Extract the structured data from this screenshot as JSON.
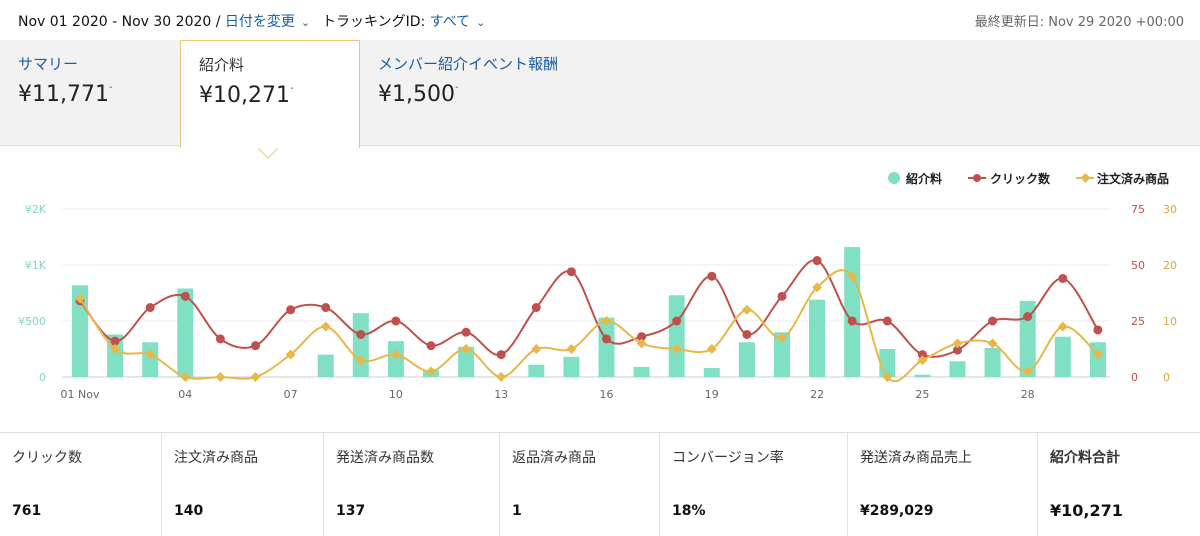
{
  "header": {
    "date_range": "Nov 01 2020 - Nov 30 2020 /",
    "change_date": "日付を変更",
    "tracking_label": "トラッキングID:",
    "tracking_value": "すべて",
    "last_updated": "最終更新日: Nov 29 2020 +00:00"
  },
  "tabs": [
    {
      "label": "サマリー",
      "value": "¥11,771"
    },
    {
      "label": "紹介料",
      "value": "¥10,271"
    },
    {
      "label": "メンバー紹介イベント報酬",
      "value": "¥1,500"
    }
  ],
  "value_suffix": "-",
  "icons": {
    "chevron": "chevron-down-icon"
  },
  "colors": {
    "bars": "#7fe0c3",
    "clicks": "#c0504d",
    "orders": "#e6b84a",
    "link": "#1a5ea8"
  },
  "stats": [
    {
      "label": "クリック数",
      "value": "761"
    },
    {
      "label": "注文済み商品",
      "value": "140"
    },
    {
      "label": "発送済み商品数",
      "value": "137"
    },
    {
      "label": "返品済み商品",
      "value": "1"
    },
    {
      "label": "コンバージョン率",
      "value": "18%"
    },
    {
      "label": "発送済み商品売上",
      "value": "¥289,029"
    },
    {
      "label": "紹介料合計",
      "value": "¥10,271"
    }
  ],
  "chart_data": {
    "type": "bar",
    "x": [
      1,
      2,
      3,
      4,
      5,
      6,
      7,
      8,
      9,
      10,
      11,
      12,
      13,
      14,
      15,
      16,
      17,
      18,
      19,
      20,
      21,
      22,
      23,
      24,
      25,
      26,
      27,
      28,
      29,
      30
    ],
    "x_tick_labels": [
      {
        "x": 1,
        "label": "01 Nov"
      },
      {
        "x": 4,
        "label": "04"
      },
      {
        "x": 7,
        "label": "07"
      },
      {
        "x": 10,
        "label": "10"
      },
      {
        "x": 13,
        "label": "13"
      },
      {
        "x": 16,
        "label": "16"
      },
      {
        "x": 19,
        "label": "19"
      },
      {
        "x": 22,
        "label": "22"
      },
      {
        "x": 25,
        "label": "25"
      },
      {
        "x": 28,
        "label": "28"
      }
    ],
    "series": [
      {
        "name": "紹介料",
        "type": "bar",
        "axis": "left",
        "values": [
          820,
          380,
          310,
          790,
          0,
          0,
          0,
          200,
          570,
          320,
          60,
          270,
          0,
          110,
          180,
          530,
          90,
          730,
          80,
          310,
          400,
          690,
          1160,
          250,
          20,
          140,
          260,
          680,
          360,
          310
        ]
      },
      {
        "name": "クリック数",
        "type": "line",
        "axis": "right1",
        "values": [
          34,
          16,
          31,
          36,
          17,
          14,
          30,
          31,
          19,
          25,
          14,
          20,
          10,
          31,
          47,
          17,
          18,
          25,
          45,
          19,
          36,
          52,
          25,
          25,
          10,
          12,
          25,
          27,
          44,
          21
        ]
      },
      {
        "name": "注文済み商品",
        "type": "line",
        "axis": "right2",
        "values": [
          14,
          5,
          4,
          0,
          0,
          0,
          4,
          9,
          3,
          4,
          1,
          5,
          0,
          5,
          5,
          10,
          6,
          5,
          5,
          12,
          7,
          16,
          18,
          0,
          3,
          6,
          6,
          1,
          9,
          4
        ]
      }
    ],
    "left_axis": {
      "ticks": [
        "0",
        "¥500",
        "¥1K",
        "¥2K"
      ],
      "tick_values": [
        0,
        500,
        1000,
        1500
      ],
      "ylim": [
        0,
        1500
      ]
    },
    "right1_axis": {
      "ticks": [
        "0",
        "25",
        "50",
        "75"
      ],
      "tick_values": [
        0,
        25,
        50,
        75
      ],
      "ylim": [
        0,
        75
      ]
    },
    "right2_axis": {
      "ticks": [
        "0",
        "10",
        "20",
        "30"
      ],
      "tick_values": [
        0,
        10,
        20,
        30
      ],
      "ylim": [
        0,
        30
      ]
    },
    "legend_position": "top-right",
    "grid": true
  }
}
